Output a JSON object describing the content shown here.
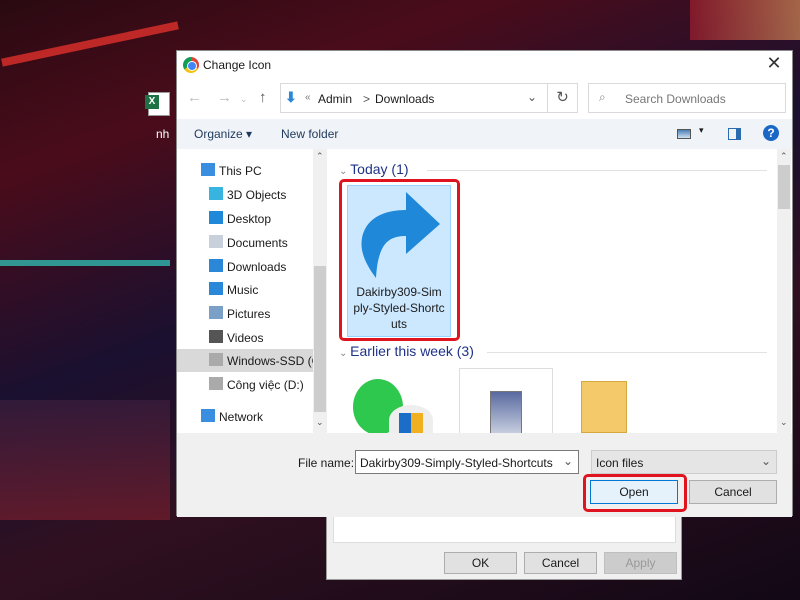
{
  "desktop": {
    "icon_label": "nh"
  },
  "dialog": {
    "title": "Change Icon",
    "close_label": "✕",
    "address": {
      "prefix": "«",
      "path": [
        "Admin",
        "Downloads"
      ],
      "separator": ">"
    },
    "search_placeholder": "Search Downloads",
    "toolbar": {
      "organize": "Organize ▾",
      "new_folder": "New folder"
    },
    "nav_items": [
      {
        "label": "This PC",
        "icon": "pc-icon"
      },
      {
        "label": "3D Objects",
        "icon": "3d-objects-icon"
      },
      {
        "label": "Desktop",
        "icon": "desktop-icon"
      },
      {
        "label": "Documents",
        "icon": "documents-icon"
      },
      {
        "label": "Downloads",
        "icon": "downloads-icon"
      },
      {
        "label": "Music",
        "icon": "music-icon"
      },
      {
        "label": "Pictures",
        "icon": "pictures-icon"
      },
      {
        "label": "Videos",
        "icon": "videos-icon"
      },
      {
        "label": "Windows-SSD (C:)",
        "icon": "drive-icon",
        "selected": true
      },
      {
        "label": "Công việc (D:)",
        "icon": "drive-icon"
      },
      {
        "label": "Network",
        "icon": "network-icon"
      }
    ],
    "groups": [
      {
        "label": "Today (1)",
        "items": [
          {
            "name": "Dakirby309-Simply-Styled-Shortcuts",
            "name_lines": [
              "Dakirby309-Sim",
              "ply-Styled-Shortc",
              "uts"
            ],
            "selected": true
          }
        ]
      },
      {
        "label": "Earlier this week (3)"
      }
    ],
    "file_name_label": "File name:",
    "file_name_value": "Dakirby309-Simply-Styled-Shortcuts",
    "file_type": "Icon files",
    "open_label": "Open",
    "cancel_label": "Cancel",
    "highlight_color": "#e0141e"
  },
  "back_dialog": {
    "ok": "OK",
    "cancel": "Cancel",
    "apply": "Apply"
  }
}
